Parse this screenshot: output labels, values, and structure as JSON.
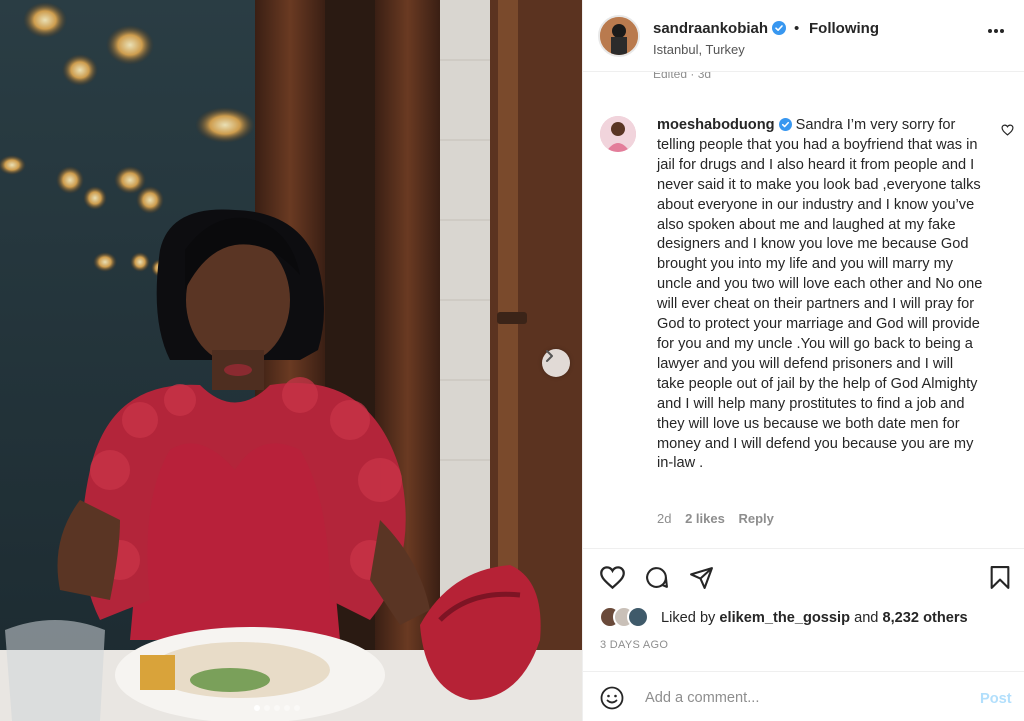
{
  "post": {
    "username": "sandraankobiah",
    "follow_state": "Following",
    "bullet": "•",
    "location": "Istanbul, Turkey",
    "edited_label": "Edited · 3d"
  },
  "comment": {
    "username": "moeshaboduong",
    "text": "Sandra I’m very sorry for telling people that you had a boyfriend that was in jail for drugs and I also heard it from people and I never said it to make you look bad ,everyone talks about everyone in our industry and I know you’ve also spoken about me and laughed at my fake designers and I know you love me because God brought you into my life and you will marry my uncle and you two will love each other and No one will ever cheat on their partners and I will pray for God to protect your marriage and God will provide for you and my uncle .You will go back to being a lawyer and you will defend prisoners and I will take people out of jail by the help of God Almighty and I will help many prostitutes to find a job and they will love us because we both date men for money and I will defend you because you are my in-law .",
    "age": "2d",
    "likes": "2 likes",
    "reply_label": "Reply"
  },
  "likes": {
    "prefix": "Liked by",
    "liker": "elikem_the_gossip",
    "and_label": "and",
    "others": "8,232 others"
  },
  "timestamp": "3 DAYS AGO",
  "add_comment": {
    "placeholder": "Add a comment...",
    "post_label": "Post"
  },
  "colors": {
    "verified": "#3897f0",
    "post_button_disabled": "#b2dffc",
    "muted_text": "#8e8e8e"
  },
  "icons": {
    "header_more": "more-horizontal-icon",
    "comment_like": "heart-outline-icon",
    "like": "heart-icon",
    "comment": "comment-bubble-icon",
    "share": "paper-plane-icon",
    "save": "bookmark-icon",
    "emoji": "smiley-icon",
    "carousel": "chevron-right-icon"
  },
  "carousel": {
    "slide_count": 5,
    "current_slide": 1
  }
}
